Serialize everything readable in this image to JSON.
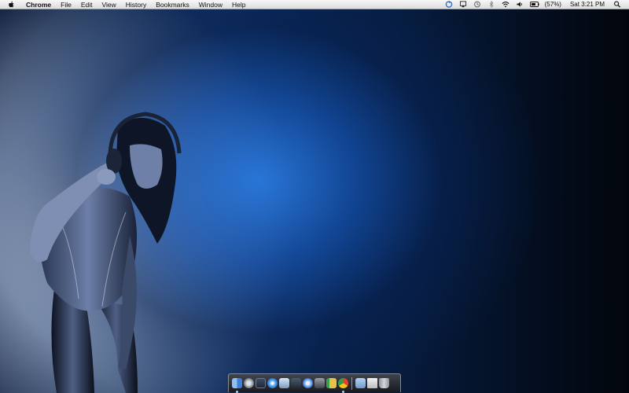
{
  "menubar": {
    "app_name": "Chrome",
    "menus": [
      "File",
      "Edit",
      "View",
      "History",
      "Bookmarks",
      "Window",
      "Help"
    ],
    "battery": "(57%)",
    "clock": "Sat 3:21 PM"
  },
  "status_icons": [
    "sync-icon",
    "airplay-icon",
    "time-machine-icon",
    "bluetooth-icon",
    "wifi-icon",
    "volume-icon",
    "battery-icon",
    "spotlight-icon"
  ],
  "dock": {
    "apps": [
      {
        "name": "finder-icon",
        "color": "#4c8ee8",
        "running": true
      },
      {
        "name": "launchpad-icon",
        "color": "#8a8f99",
        "running": false
      },
      {
        "name": "mission-control-icon",
        "color": "#2e3a4c",
        "running": false
      },
      {
        "name": "safari-icon",
        "color": "#3a8ee0",
        "running": false
      },
      {
        "name": "preview-icon",
        "color": "#9ab8d8",
        "running": false
      },
      {
        "name": "facetime-icon",
        "color": "#3a4a5a",
        "running": false
      },
      {
        "name": "itunes-icon",
        "color": "#3c78d8",
        "running": false
      },
      {
        "name": "photo-booth-icon",
        "color": "#5a5e66",
        "running": false
      },
      {
        "name": "address-book-icon",
        "color": "#b8a060",
        "running": false
      },
      {
        "name": "chrome-icon",
        "color": "#e34133",
        "running": true
      }
    ],
    "stacks": [
      {
        "name": "documents-folder-icon",
        "color": "#8fb7e0"
      },
      {
        "name": "mail-stack-icon",
        "color": "#d8d8d8"
      },
      {
        "name": "trash-icon",
        "color": "#b0b4ba"
      }
    ]
  }
}
